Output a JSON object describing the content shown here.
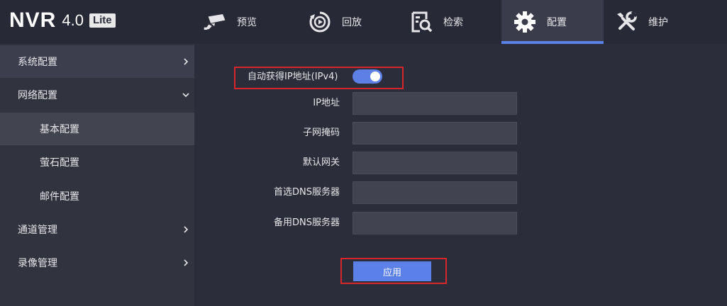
{
  "brand": {
    "name": "NVR",
    "version": "4.0",
    "tag": "Lite"
  },
  "tabs": [
    {
      "label": "预览",
      "icon": "camera-icon"
    },
    {
      "label": "回放",
      "icon": "playback-icon"
    },
    {
      "label": "检索",
      "icon": "search-doc-icon"
    },
    {
      "label": "配置",
      "icon": "gear-icon",
      "active": true
    },
    {
      "label": "维护",
      "icon": "tools-icon"
    }
  ],
  "sidebar": {
    "items": [
      {
        "label": "系统配置",
        "level": 1,
        "chevron": "right"
      },
      {
        "label": "网络配置",
        "level": 1,
        "chevron": "down",
        "expanded": true
      },
      {
        "label": "基本配置",
        "level": 2,
        "selected": true
      },
      {
        "label": "萤石配置",
        "level": 2
      },
      {
        "label": "邮件配置",
        "level": 2
      },
      {
        "label": "通道管理",
        "level": 1,
        "chevron": "right"
      },
      {
        "label": "录像管理",
        "level": 1,
        "chevron": "right"
      }
    ]
  },
  "form": {
    "dhcp_label": "自动获得IP地址(IPv4)",
    "dhcp_enabled": true,
    "fields": [
      {
        "label": "IP地址",
        "value": ""
      },
      {
        "label": "子网掩码",
        "value": ""
      },
      {
        "label": "默认网关",
        "value": ""
      },
      {
        "label": "首选DNS服务器",
        "value": ""
      },
      {
        "label": "备用DNS服务器",
        "value": ""
      }
    ],
    "apply_label": "应用"
  },
  "colors": {
    "accent": "#5b80e8",
    "highlight_border": "#d9262a",
    "background": "#2b2d3a",
    "sidebar": "#31333f"
  }
}
